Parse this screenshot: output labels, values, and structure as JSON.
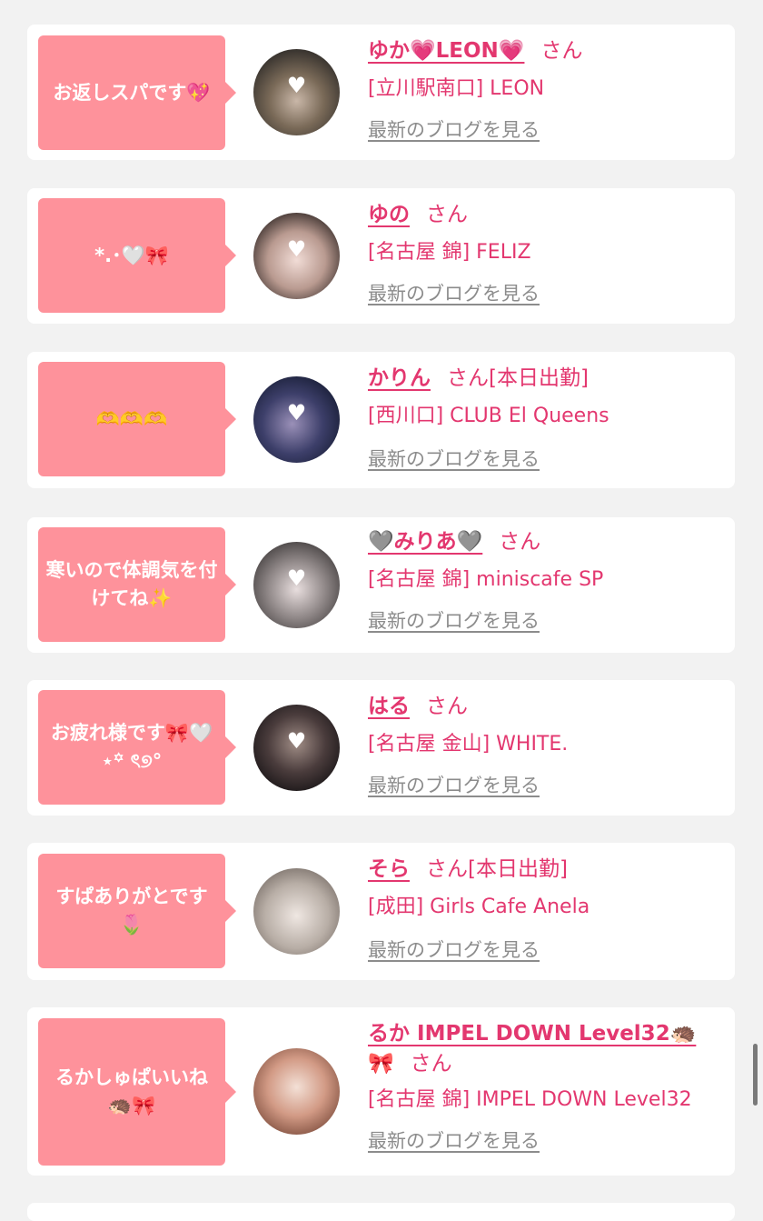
{
  "entries": [
    {
      "bubble": "お返しスパです💖",
      "name": "ゆか💗LEON💗",
      "suffix": "さん",
      "shop": "[立川駅南口] LEON",
      "blog_link": "最新のブログを見る",
      "avatar_color": "#4a4438"
    },
    {
      "bubble": "*.･🤍🎀",
      "name": "ゆの",
      "suffix": "さん",
      "shop": "[名古屋 錦] FELIZ",
      "blog_link": "最新のブログを見る",
      "avatar_color": "#d8c6bf"
    },
    {
      "bubble": "🫶🫶🫶",
      "name": "かりん",
      "suffix": "さん[本日出勤]",
      "shop": "[西川口] CLUB El Queens",
      "blog_link": "最新のブログを見る",
      "avatar_color": "#1e2540"
    },
    {
      "bubble": "寒いので体調気を付けてね✨",
      "name": "🩶みりあ🩶",
      "suffix": "さん",
      "shop": "[名古屋 錦] miniscafe SP",
      "blog_link": "最新のブログを見る",
      "avatar_color": "#6f6a6a"
    },
    {
      "bubble": "お疲れ様です🎀🤍⋆꙳ ৎ୭°",
      "name": "はる",
      "suffix": "さん",
      "shop": "[名古屋 金山] WHITE.",
      "blog_link": "最新のブログを見る",
      "avatar_color": "#2a2426"
    },
    {
      "bubble": "すぱありがとです🌷",
      "name": "そら",
      "suffix": "さん[本日出勤]",
      "shop": "[成田] Girls Cafe Anela",
      "blog_link": "最新のブログを見る",
      "avatar_color": "#cfc8c2"
    },
    {
      "bubble": "るかしゅぱいいね🦔🎀",
      "name": "るか IMPEL DOWN Level32🦔",
      "name_line2": "🎀",
      "suffix": "さん",
      "shop": "[名古屋 錦] IMPEL DOWN Level32",
      "blog_link": "最新のブログを見る",
      "avatar_color": "#d9b9a3"
    }
  ],
  "colors": {
    "accent": "#e3376f",
    "bubble": "#fe929b",
    "link_gray": "#8c8c8c",
    "background": "#f2f2f2"
  }
}
